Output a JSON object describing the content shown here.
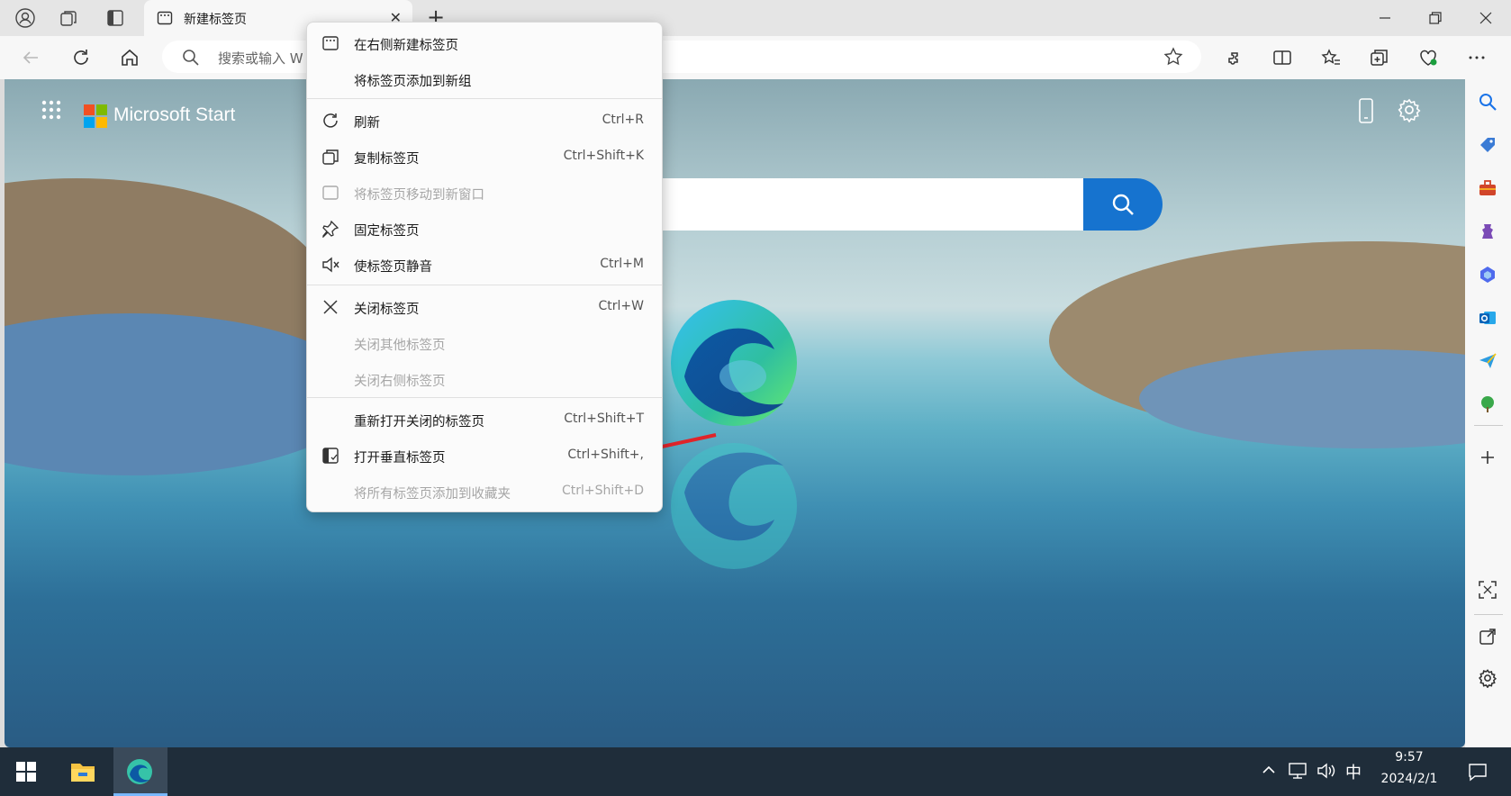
{
  "tab": {
    "title": "新建标签页"
  },
  "address": {
    "placeholder": "搜索或输入 W"
  },
  "newtab": {
    "brand": "Microsoft Start"
  },
  "context_menu": {
    "items": [
      {
        "label": "在右侧新建标签页",
        "shortcut": "",
        "icon": "tab-icon",
        "disabled": false
      },
      {
        "label": "将标签页添加到新组",
        "shortcut": "",
        "icon": "",
        "disabled": false
      },
      {
        "label": "刷新",
        "shortcut": "Ctrl+R",
        "icon": "refresh-icon",
        "disabled": false
      },
      {
        "label": "复制标签页",
        "shortcut": "Ctrl+Shift+K",
        "icon": "duplicate-icon",
        "disabled": false
      },
      {
        "label": "将标签页移动到新窗口",
        "shortcut": "",
        "icon": "window-icon",
        "disabled": true
      },
      {
        "label": "固定标签页",
        "shortcut": "",
        "icon": "pin-icon",
        "disabled": false
      },
      {
        "label": "使标签页静音",
        "shortcut": "Ctrl+M",
        "icon": "mute-icon",
        "disabled": false
      },
      {
        "label": "关闭标签页",
        "shortcut": "Ctrl+W",
        "icon": "close-icon",
        "disabled": false
      },
      {
        "label": "关闭其他标签页",
        "shortcut": "",
        "icon": "",
        "disabled": true
      },
      {
        "label": "关闭右侧标签页",
        "shortcut": "",
        "icon": "",
        "disabled": true
      },
      {
        "label": "重新打开关闭的标签页",
        "shortcut": "Ctrl+Shift+T",
        "icon": "",
        "disabled": false
      },
      {
        "label": "打开垂直标签页",
        "shortcut": "Ctrl+Shift+,",
        "icon": "vertical-tabs-icon",
        "disabled": false
      },
      {
        "label": "将所有标签页添加到收藏夹",
        "shortcut": "Ctrl+Shift+D",
        "icon": "",
        "disabled": true
      }
    ]
  },
  "taskbar": {
    "time": "9:57",
    "date": "2024/2/1",
    "ime": "中"
  },
  "colors": {
    "accent": "#1673cf",
    "annotation_arrow": "#e0242a",
    "taskbar": "#1f2d3a"
  }
}
